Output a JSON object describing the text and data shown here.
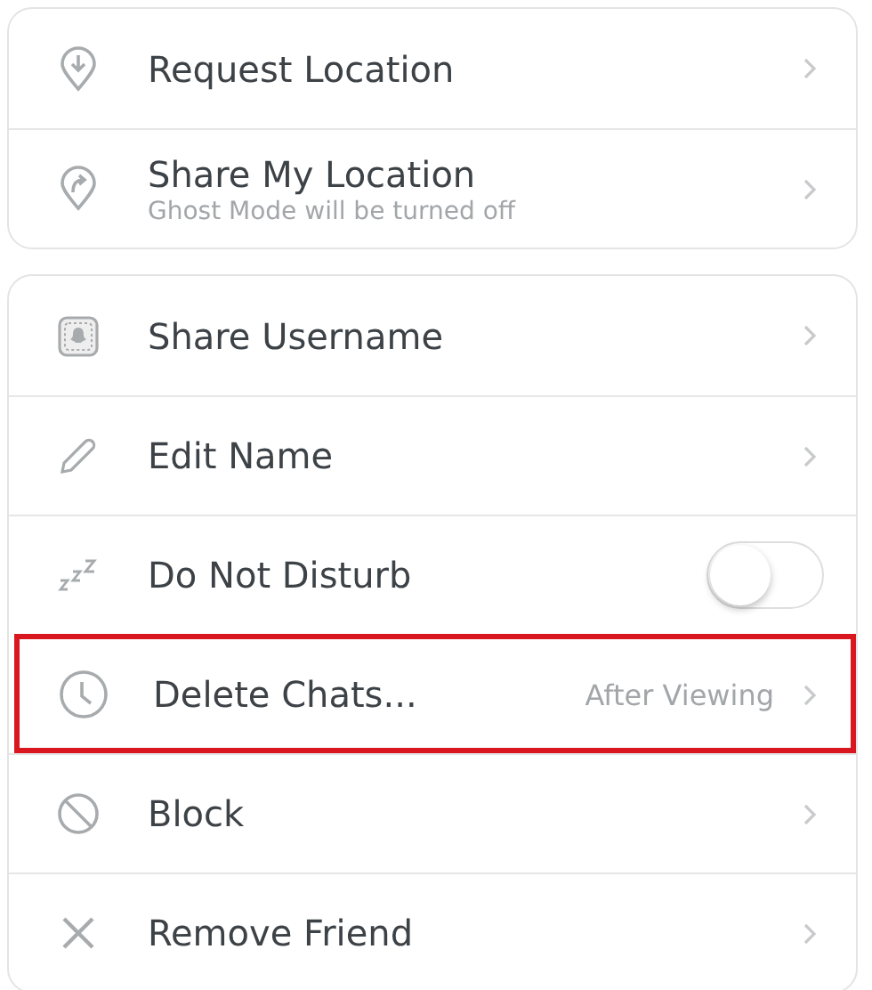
{
  "cards": [
    {
      "rows": [
        {
          "kind": "chevron",
          "label": "Request Location",
          "highlighted": false
        },
        {
          "kind": "chevron",
          "label": "Share My Location",
          "subtitle": "Ghost Mode will be turned off",
          "highlighted": false
        }
      ]
    },
    {
      "rows": [
        {
          "kind": "chevron",
          "label": "Share Username",
          "highlighted": false
        },
        {
          "kind": "chevron",
          "label": "Edit Name",
          "highlighted": false
        },
        {
          "kind": "toggle",
          "label": "Do Not Disturb",
          "on": false,
          "highlighted": false
        },
        {
          "kind": "chevron",
          "label": "Delete Chats...",
          "value": "After Viewing",
          "highlighted": true
        },
        {
          "kind": "chevron",
          "label": "Block",
          "highlighted": false
        },
        {
          "kind": "chevron",
          "label": "Remove Friend",
          "highlighted": false
        }
      ]
    }
  ]
}
